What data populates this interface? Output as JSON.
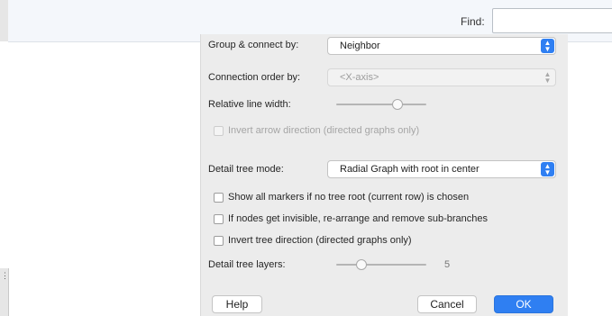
{
  "find": {
    "label": "Find:",
    "value": ""
  },
  "sidebar_marks": "⋮",
  "form": {
    "group_connect": {
      "label": "Group & connect by:",
      "value": "Neighbor",
      "arrow": "◆"
    },
    "connection_order": {
      "label": "Connection order by:",
      "value": "<X-axis>",
      "arrow": "◇"
    },
    "relative_line_width": {
      "label": "Relative line width:",
      "slider_fraction": 0.68
    },
    "invert_arrow": {
      "label": "Invert arrow direction (directed graphs only)",
      "checked": false,
      "disabled": true
    },
    "detail_tree_mode": {
      "label": "Detail tree mode:",
      "value": "Radial Graph with root in center",
      "arrow": "◆"
    },
    "checkboxes": [
      {
        "label": "Show all markers if no tree root (current row) is chosen",
        "checked": false
      },
      {
        "label": "If nodes get invisible, re-arrange and remove sub-branches",
        "checked": false
      },
      {
        "label": "Invert tree direction (directed graphs only)",
        "checked": false
      }
    ],
    "detail_tree_layers": {
      "label": "Detail tree layers:",
      "value": "5",
      "slider_fraction": 0.28
    }
  },
  "buttons": {
    "help": "Help",
    "cancel": "Cancel",
    "ok": "OK"
  }
}
